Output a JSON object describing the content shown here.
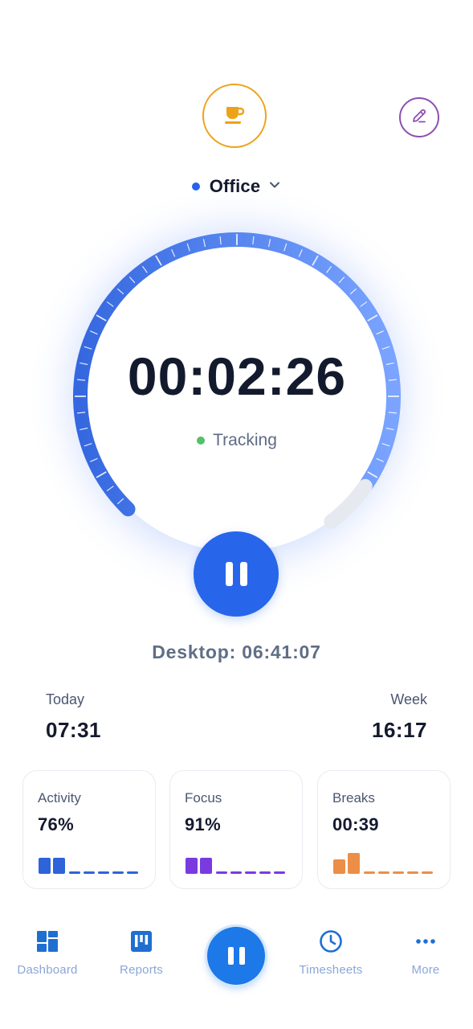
{
  "header": {
    "break_icon": "coffee-cup-icon",
    "edit_icon": "pencil-icon"
  },
  "project": {
    "name": "Office",
    "dot_color": "#2563eb"
  },
  "timer": {
    "time": "00:02:26",
    "status": "Tracking",
    "status_color": "#55c068",
    "pause_icon": "pause-icon"
  },
  "desktop": {
    "text": "Desktop: 06:41:07"
  },
  "totals": {
    "today_label": "Today",
    "today_value": "07:31",
    "week_label": "Week",
    "week_value": "16:17"
  },
  "cards": [
    {
      "title": "Activity",
      "value": "76%",
      "color": "#2f63d9",
      "filled_bars": 2
    },
    {
      "title": "Focus",
      "value": "91%",
      "color": "#7a3ae0",
      "filled_bars": 2
    },
    {
      "title": "Breaks",
      "value": "00:39",
      "color": "#ec8e47",
      "filled_bars": 2
    }
  ],
  "nav": {
    "items": [
      {
        "label": "Dashboard",
        "icon": "dashboard-grid-icon"
      },
      {
        "label": "Reports",
        "icon": "reports-board-icon"
      },
      {
        "label": "Timesheets",
        "icon": "clock-icon"
      },
      {
        "label": "More",
        "icon": "more-dots-icon"
      }
    ],
    "fab_icon": "pause-icon",
    "accent": "#1d78e8"
  },
  "colors": {
    "dial_start": "#3568e0",
    "dial_end": "#7aa4ff",
    "text_primary": "#141a2e"
  }
}
